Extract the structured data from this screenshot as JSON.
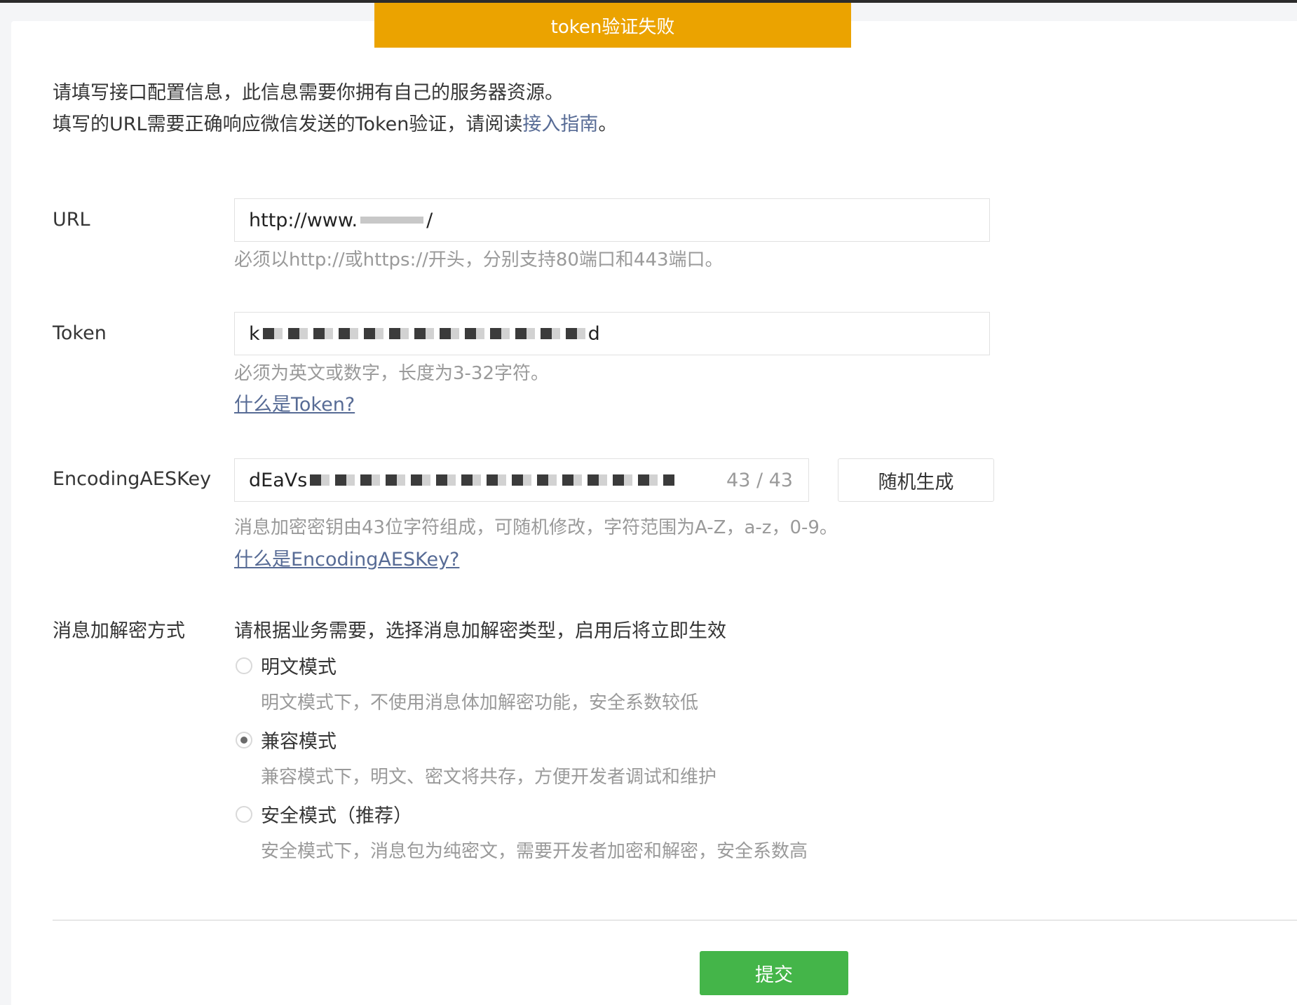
{
  "toast": {
    "message": "token验证失败"
  },
  "intro": {
    "line1": "请填写接口配置信息，此信息需要你拥有自己的服务器资源。",
    "line2_prefix": "填写的URL需要正确响应微信发送的Token验证，请阅读",
    "line2_link": "接入指南",
    "line2_suffix": "。"
  },
  "url": {
    "label": "URL",
    "value_visible": "http://www.",
    "value_tail": "/",
    "hint": "必须以http://或https://开头，分别支持80端口和443端口。"
  },
  "token": {
    "label": "Token",
    "value_prefix": "k",
    "value_suffix": "d",
    "hint": "必须为英文或数字，长度为3-32字符。",
    "help_link": "什么是Token?"
  },
  "aeskey": {
    "label": "EncodingAESKey",
    "value_prefix": "dEaVs",
    "counter": "43 / 43",
    "generate_button": "随机生成",
    "hint": "消息加密密钥由43位字符组成，可随机修改，字符范围为A-Z，a-z，0-9。",
    "help_link": "什么是EncodingAESKey?"
  },
  "encryption": {
    "label": "消息加解密方式",
    "description": "请根据业务需要，选择消息加解密类型，启用后将立即生效",
    "options": [
      {
        "label": "明文模式",
        "desc": "明文模式下，不使用消息体加解密功能，安全系数较低",
        "checked": false
      },
      {
        "label": "兼容模式",
        "desc": "兼容模式下，明文、密文将共存，方便开发者调试和维护",
        "checked": true
      },
      {
        "label": "安全模式（推荐）",
        "desc": "安全模式下，消息包为纯密文，需要开发者加密和解密，安全系数高",
        "checked": false
      }
    ]
  },
  "submit": {
    "label": "提交"
  },
  "colors": {
    "toast": "#eba300",
    "link": "#576b95",
    "submit": "#44b549",
    "hint": "#9a9a9a"
  }
}
